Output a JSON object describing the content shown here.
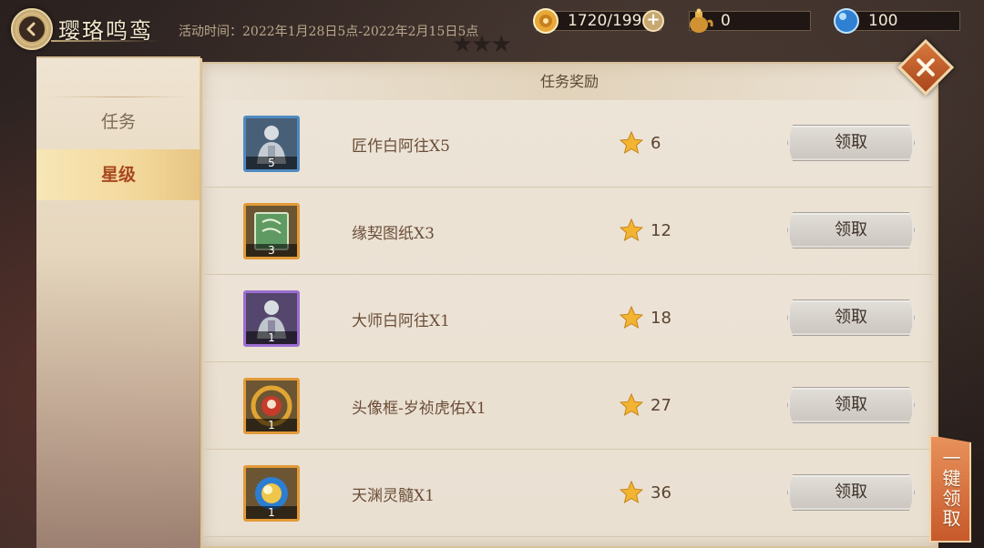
{
  "header": {
    "title": "璎珞鸣鸾",
    "event_time": "活动时间：2022年1月28日5点-2022年2月15日5点"
  },
  "resources": {
    "gold": "1720/199",
    "pot": "0",
    "jade": "100"
  },
  "tabs": [
    {
      "label": "任务",
      "selected": false
    },
    {
      "label": "星级",
      "selected": true
    }
  ],
  "panel": {
    "title": "任务奖励"
  },
  "rewards": [
    {
      "name": "匠作白阿往X5",
      "count": "5",
      "stars": "6",
      "button": "领取",
      "frame": "blue"
    },
    {
      "name": "缘契图纸X3",
      "count": "3",
      "stars": "12",
      "button": "领取",
      "frame": "orange"
    },
    {
      "name": "大师白阿往X1",
      "count": "1",
      "stars": "18",
      "button": "领取",
      "frame": "purple"
    },
    {
      "name": "头像框-岁祯虎佑X1",
      "count": "1",
      "stars": "27",
      "button": "领取",
      "frame": "orange"
    },
    {
      "name": "天渊灵髓X1",
      "count": "1",
      "stars": "36",
      "button": "领取",
      "frame": "orange"
    }
  ],
  "claim_all": "一键领取",
  "colors": {
    "accent": "#c7592b",
    "tab_selected_text": "#a8481f",
    "star": "#f2b431"
  }
}
